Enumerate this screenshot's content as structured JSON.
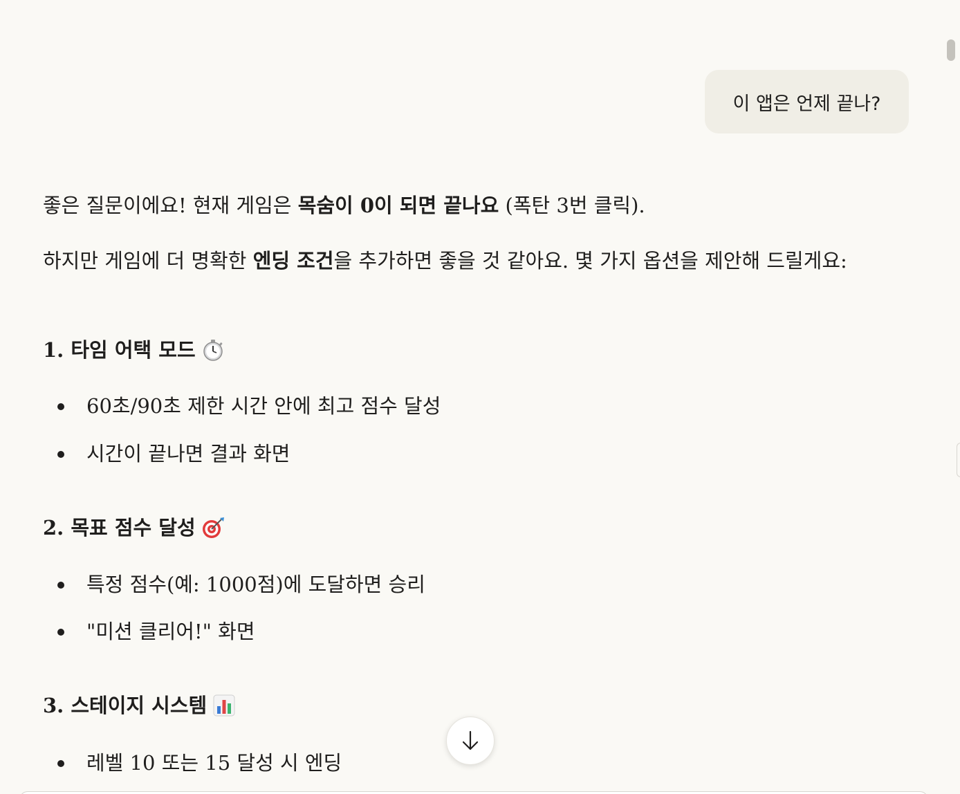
{
  "user_message": "이 앱은 언제 끝나?",
  "reply": {
    "p1": {
      "before": "좋은 질문이에요! 현재 게임은 ",
      "bold": "목숨이 0이 되면 끝나요",
      "after": " (폭탄 3번 클릭)."
    },
    "p2": {
      "before": "하지만 게임에 더 명확한 ",
      "bold": "엔딩 조건",
      "after": "을 추가하면 좋을 것 같아요. 몇 가지 옵션을 제안해 드릴게요:"
    },
    "sections": [
      {
        "title": "1. 타임 어택 모드",
        "icon": "stopwatch-emoji",
        "bullets": [
          "60초/90초 제한 시간 안에 최고 점수 달성",
          "시간이 끝나면 결과 화면"
        ]
      },
      {
        "title": "2. 목표 점수 달성",
        "icon": "target-emoji",
        "bullets": [
          "특정 점수(예: 1000점)에 도달하면 승리",
          "\"미션 클리어!\" 화면"
        ]
      },
      {
        "title": "3. 스테이지 시스템",
        "icon": "bar-chart-emoji",
        "bullets": [
          "레벨 10 또는 15 달성 시 엔딩"
        ]
      }
    ]
  },
  "colors": {
    "background": "#faf9f5",
    "user_bubble": "#f0eee6",
    "text": "#1f1e1d"
  }
}
